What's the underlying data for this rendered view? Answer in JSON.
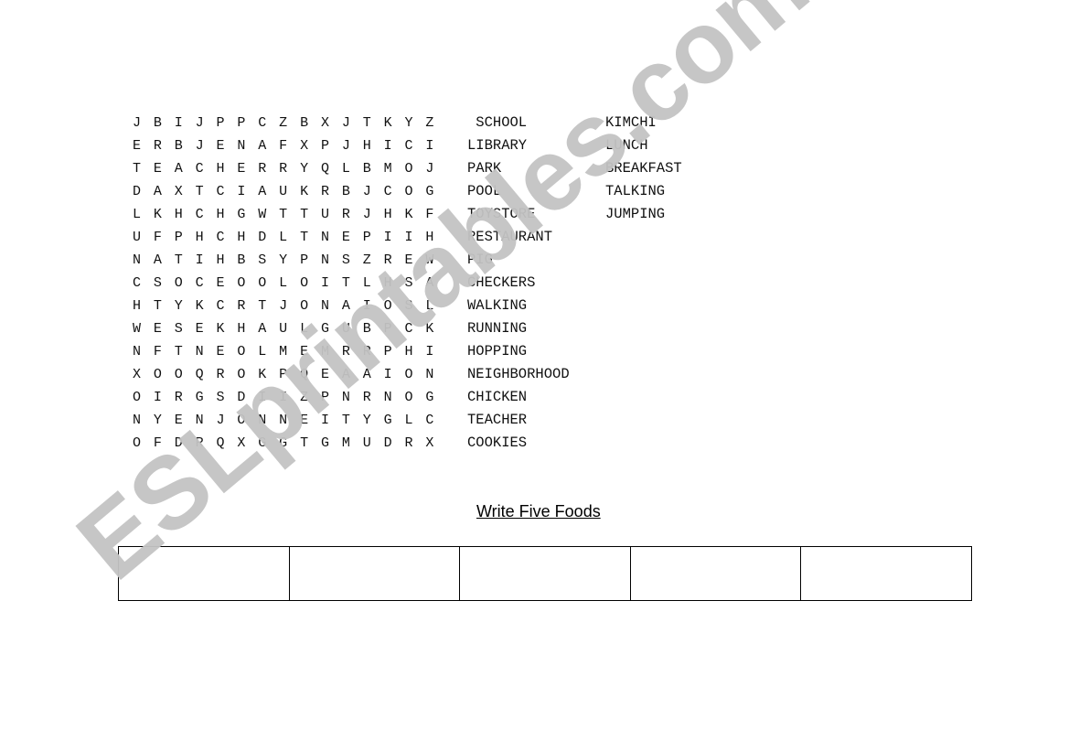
{
  "word_search": {
    "grid": [
      [
        "J",
        "B",
        "I",
        "J",
        "P",
        "P",
        "C",
        "Z",
        "B",
        "X",
        "J",
        "T",
        "K",
        "Y",
        "Z"
      ],
      [
        "E",
        "R",
        "B",
        "J",
        "E",
        "N",
        "A",
        "F",
        "X",
        "P",
        "J",
        "H",
        "I",
        "C",
        "I"
      ],
      [
        "T",
        "E",
        "A",
        "C",
        "H",
        "E",
        "R",
        "R",
        "Y",
        "Q",
        "L",
        "B",
        "M",
        "O",
        "J"
      ],
      [
        "D",
        "A",
        "X",
        "T",
        "C",
        "I",
        "A",
        "U",
        "K",
        "R",
        "B",
        "J",
        "C",
        "O",
        "G"
      ],
      [
        "L",
        "K",
        "H",
        "C",
        "H",
        "G",
        "W",
        "T",
        "T",
        "U",
        "R",
        "J",
        "H",
        "K",
        "F"
      ],
      [
        "U",
        "F",
        "P",
        "H",
        "C",
        "H",
        "D",
        "L",
        "T",
        "N",
        "E",
        "P",
        "I",
        "I",
        "H"
      ],
      [
        "N",
        "A",
        "T",
        "I",
        "H",
        "B",
        "S",
        "Y",
        "P",
        "N",
        "S",
        "Z",
        "R",
        "E",
        "W"
      ],
      [
        "C",
        "S",
        "O",
        "C",
        "E",
        "O",
        "O",
        "L",
        "O",
        "I",
        "T",
        "L",
        "H",
        "S",
        "A"
      ],
      [
        "H",
        "T",
        "Y",
        "K",
        "C",
        "R",
        "T",
        "J",
        "O",
        "N",
        "A",
        "I",
        "O",
        "S",
        "L"
      ],
      [
        "W",
        "E",
        "S",
        "E",
        "K",
        "H",
        "A",
        "U",
        "L",
        "G",
        "U",
        "B",
        "P",
        "C",
        "K"
      ],
      [
        "N",
        "F",
        "T",
        "N",
        "E",
        "O",
        "L",
        "M",
        "E",
        "M",
        "R",
        "R",
        "P",
        "H",
        "I"
      ],
      [
        "X",
        "O",
        "O",
        "Q",
        "R",
        "O",
        "K",
        "P",
        "Q",
        "E",
        "A",
        "A",
        "I",
        "O",
        "N"
      ],
      [
        "O",
        "I",
        "R",
        "G",
        "S",
        "D",
        "I",
        "I",
        "Z",
        "P",
        "N",
        "R",
        "N",
        "O",
        "G"
      ],
      [
        "N",
        "Y",
        "E",
        "N",
        "J",
        "O",
        "N",
        "N",
        "E",
        "I",
        "T",
        "Y",
        "G",
        "L",
        "C"
      ],
      [
        "O",
        "F",
        "D",
        "R",
        "Q",
        "X",
        "G",
        "G",
        "T",
        "G",
        "M",
        "U",
        "D",
        "R",
        "X"
      ]
    ],
    "word_list_1": [
      " SCHOOL",
      "LIBRARY",
      "PARK",
      "POOL",
      "TOYSTORE",
      "RESTAURANT",
      "PIG",
      "CHECKERS",
      "WALKING",
      "RUNNING",
      "HOPPING",
      "NEIGHBORHOOD",
      "CHICKEN",
      "TEACHER",
      "COOKIES"
    ],
    "word_list_2": [
      "KIMCHI",
      "LUNCH",
      "BREAKFAST",
      "TALKING",
      "JUMPING"
    ]
  },
  "foods_section": {
    "heading": "Write Five Foods",
    "answer_boxes": [
      "",
      "",
      "",
      "",
      ""
    ]
  },
  "watermark": "ESLprintables.com"
}
